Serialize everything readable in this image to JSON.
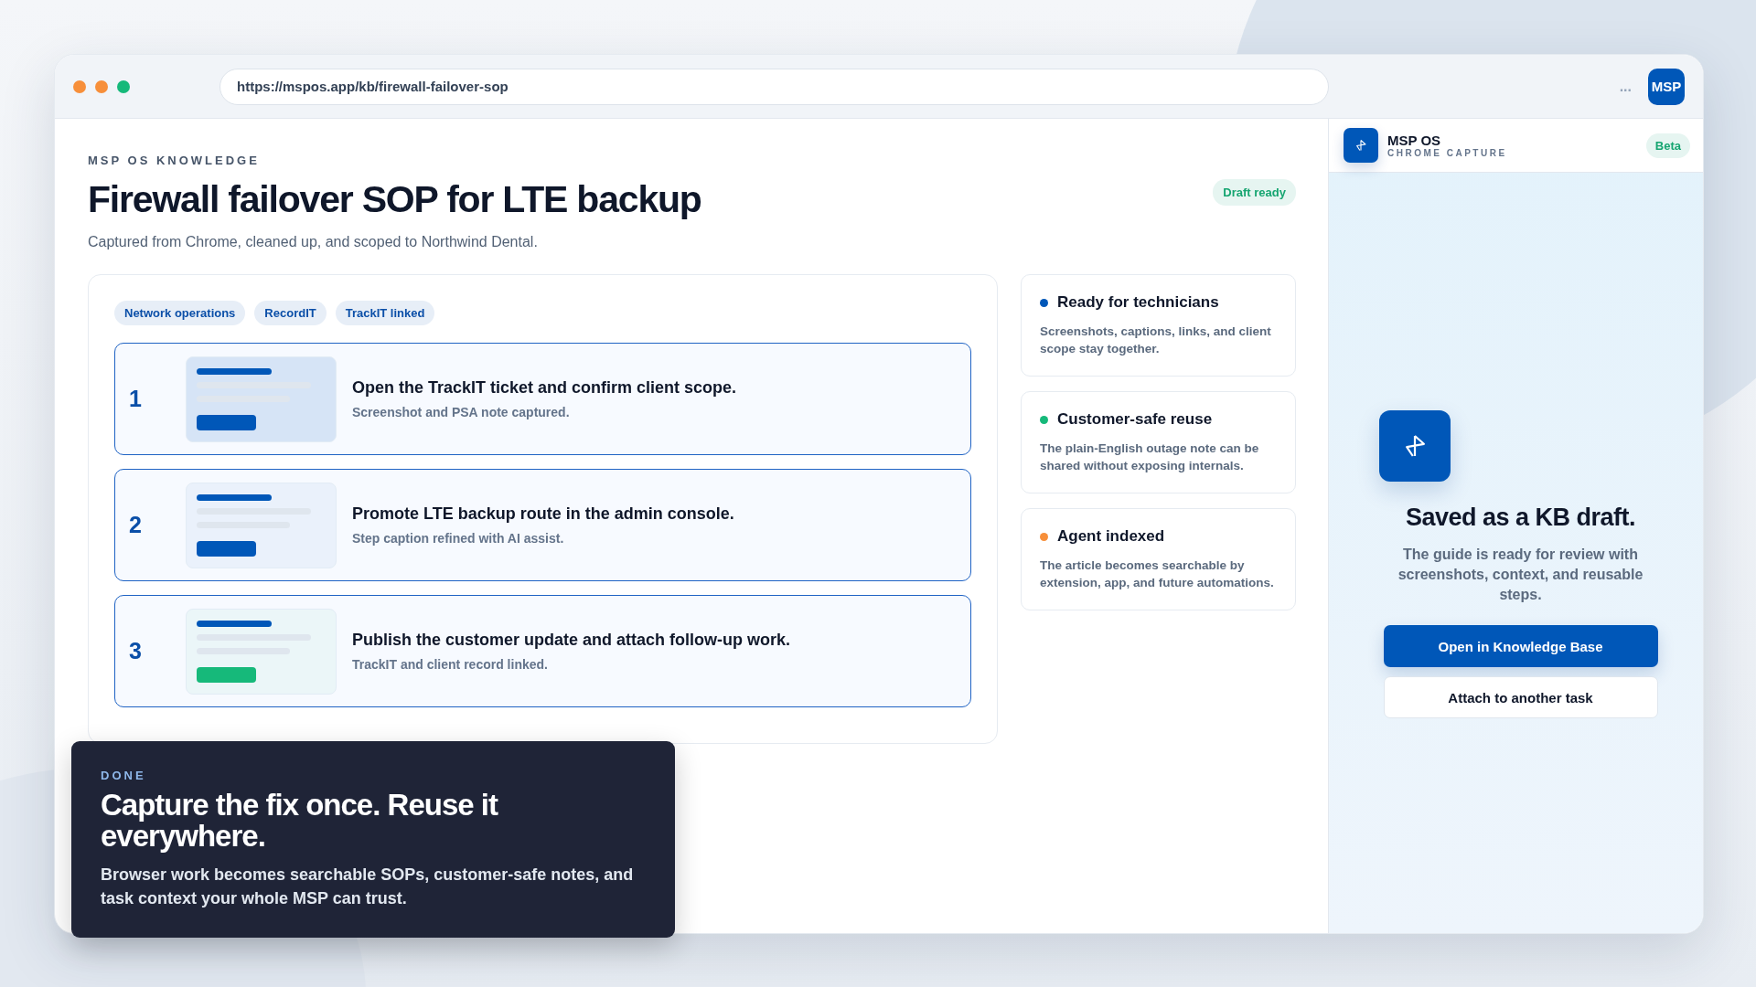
{
  "browser": {
    "url": "https://mspos.app/kb/firewall-failover-sop",
    "more": "...",
    "extension_badge": "MSP"
  },
  "article": {
    "eyebrow": "MSP OS KNOWLEDGE",
    "title": "Firewall failover SOP for LTE backup",
    "subtitle": "Captured from Chrome, cleaned up, and scoped to Northwind Dental.",
    "status": "Draft ready",
    "tags": [
      "Network operations",
      "RecordIT",
      "TrackIT linked"
    ],
    "steps": [
      {
        "number": "1",
        "title": "Open the TrackIT ticket and confirm client scope.",
        "caption": "Screenshot and PSA note captured.",
        "color": "#0057b8"
      },
      {
        "number": "2",
        "title": "Promote LTE backup route in the admin console.",
        "caption": "Step caption refined with AI assist.",
        "color": "#0057b8"
      },
      {
        "number": "3",
        "title": "Publish the customer update and attach follow-up work.",
        "caption": "TrackIT and client record linked.",
        "color": "#16b97a"
      }
    ]
  },
  "highlights": [
    {
      "title": "Ready for technicians",
      "text": "Screenshots, captions, links, and client scope stay together.",
      "color": "#0057b8"
    },
    {
      "title": "Customer-safe reuse",
      "text": "The plain-English outage note can be shared without exposing internals.",
      "color": "#16b97a"
    },
    {
      "title": "Agent indexed",
      "text": "The article becomes searchable by extension, app, and future automations.",
      "color": "#f78f3a"
    }
  ],
  "extension_panel": {
    "name": "MSP OS",
    "subtitle": "CHROME CAPTURE",
    "badge": "Beta",
    "heading": "Saved as a KB draft.",
    "text": "The guide is ready for review with screenshots, context, and reusable steps.",
    "primary_button": "Open in Knowledge Base",
    "secondary_button": "Attach to another task"
  },
  "callout": {
    "eyebrow": "DONE",
    "title": "Capture the fix once. Reuse it everywhere.",
    "text": "Browser work becomes searchable SOPs, customer-safe notes, and task context your whole MSP can trust."
  }
}
